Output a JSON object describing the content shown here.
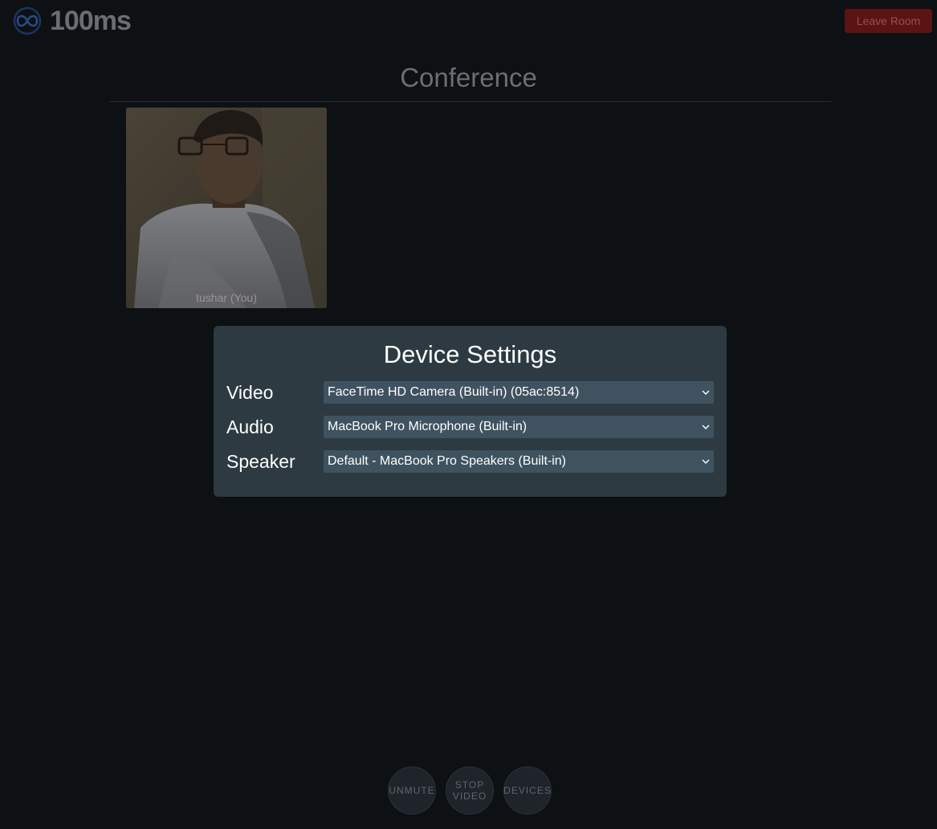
{
  "header": {
    "logo_text": "100ms",
    "logo_icon": "infinity-logo-icon",
    "leave_label": "Leave Room",
    "leave_color": "#5a1414"
  },
  "conference": {
    "title": "Conference"
  },
  "tiles": [
    {
      "name": "tushar (You)"
    }
  ],
  "device_settings": {
    "title": "Device Settings",
    "rows": [
      {
        "label": "Video",
        "value": "FaceTime HD Camera (Built-in) (05ac:8514)"
      },
      {
        "label": "Audio",
        "value": "MacBook Pro Microphone (Built-in)"
      },
      {
        "label": "Speaker",
        "value": "Default - MacBook Pro Speakers (Built-in)"
      }
    ]
  },
  "controls": {
    "mute_label": "UNMUTE",
    "video_label": "STOP\nVIDEO",
    "devices_label": "DEVICES"
  },
  "colors": {
    "background": "#0d1114",
    "modal": "#2d3a42",
    "select": "#3f5260"
  }
}
